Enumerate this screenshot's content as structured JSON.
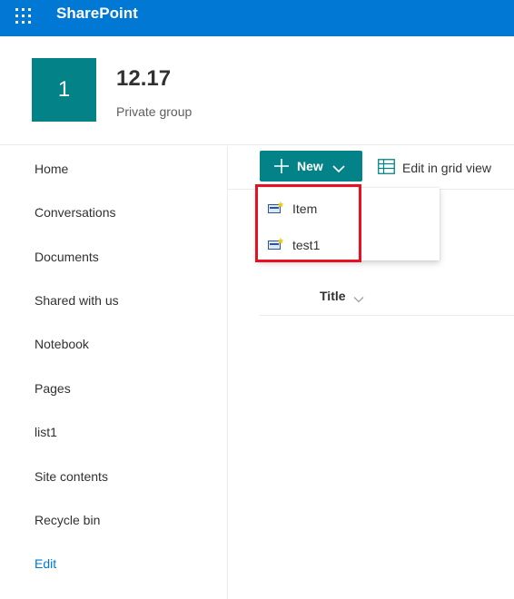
{
  "suite_bar": {
    "app_name": "SharePoint",
    "background": "#0078d4",
    "waffle_icon": "app-launcher-icon"
  },
  "site": {
    "logo_text": "1",
    "logo_color": "#038387",
    "title": "12.17",
    "subtitle": "Private group"
  },
  "left_nav": {
    "items": [
      {
        "label": "Home"
      },
      {
        "label": "Conversations"
      },
      {
        "label": "Documents"
      },
      {
        "label": "Shared with us"
      },
      {
        "label": "Notebook"
      },
      {
        "label": "Pages"
      },
      {
        "label": "list1"
      },
      {
        "label": "Site contents"
      },
      {
        "label": "Recycle bin"
      }
    ],
    "edit_label": "Edit",
    "edit_color": "#0078d4"
  },
  "command_bar": {
    "new_label": "New",
    "new_icon": "plus-icon",
    "new_chevron": "chevron-down-icon",
    "grid_view_label": "Edit in grid view",
    "grid_view_icon": "table-grid-icon"
  },
  "new_menu": {
    "items": [
      {
        "label": "Item",
        "icon": "list-item-icon"
      },
      {
        "label": "test1",
        "icon": "list-item-icon"
      }
    ],
    "highlight_color": "#e81123"
  },
  "list": {
    "columns": [
      {
        "label": "Title",
        "icon": "chevron-down-icon"
      }
    ]
  }
}
